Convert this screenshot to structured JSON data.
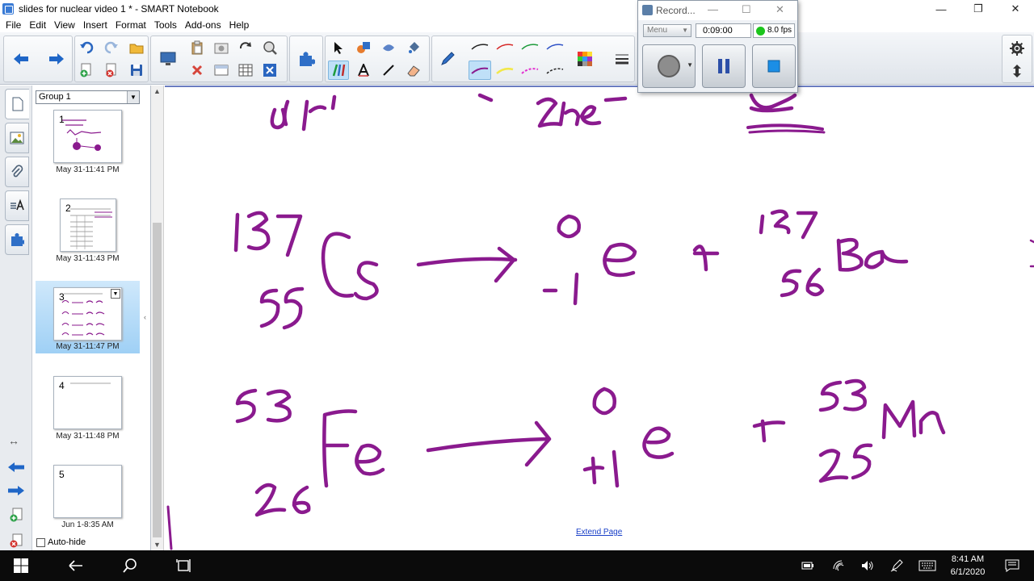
{
  "window": {
    "title": "slides for nuclear video 1 * - SMART Notebook",
    "minimize": "—",
    "restore": "❐",
    "close": "✕"
  },
  "menu": [
    "File",
    "Edit",
    "View",
    "Insert",
    "Format",
    "Tools",
    "Add-ons",
    "Help"
  ],
  "colors": {
    "ink": "#8a1a8e",
    "selected_thumb": "#a8d6f7",
    "link": "#1a40c8"
  },
  "recorder": {
    "title": "Record...",
    "menu_label": "Menu",
    "elapsed": "0:09:00",
    "fps": "8.0 fps"
  },
  "sorter": {
    "group": "Group 1",
    "pages": [
      {
        "num": "1",
        "date": "May 31-11:41 PM"
      },
      {
        "num": "2",
        "date": "May 31-11:43 PM"
      },
      {
        "num": "3",
        "date": "May 31-11:47 PM"
      },
      {
        "num": "4",
        "date": "May 31-11:48 PM"
      },
      {
        "num": "5",
        "date": "Jun 1-8:35 AM"
      }
    ],
    "selected_page": "3",
    "autohide_label": "Auto-hide"
  },
  "canvas": {
    "extend_page": "Extend Page"
  },
  "taskbar": {
    "time": "8:41 AM",
    "date": "6/1/2020"
  }
}
